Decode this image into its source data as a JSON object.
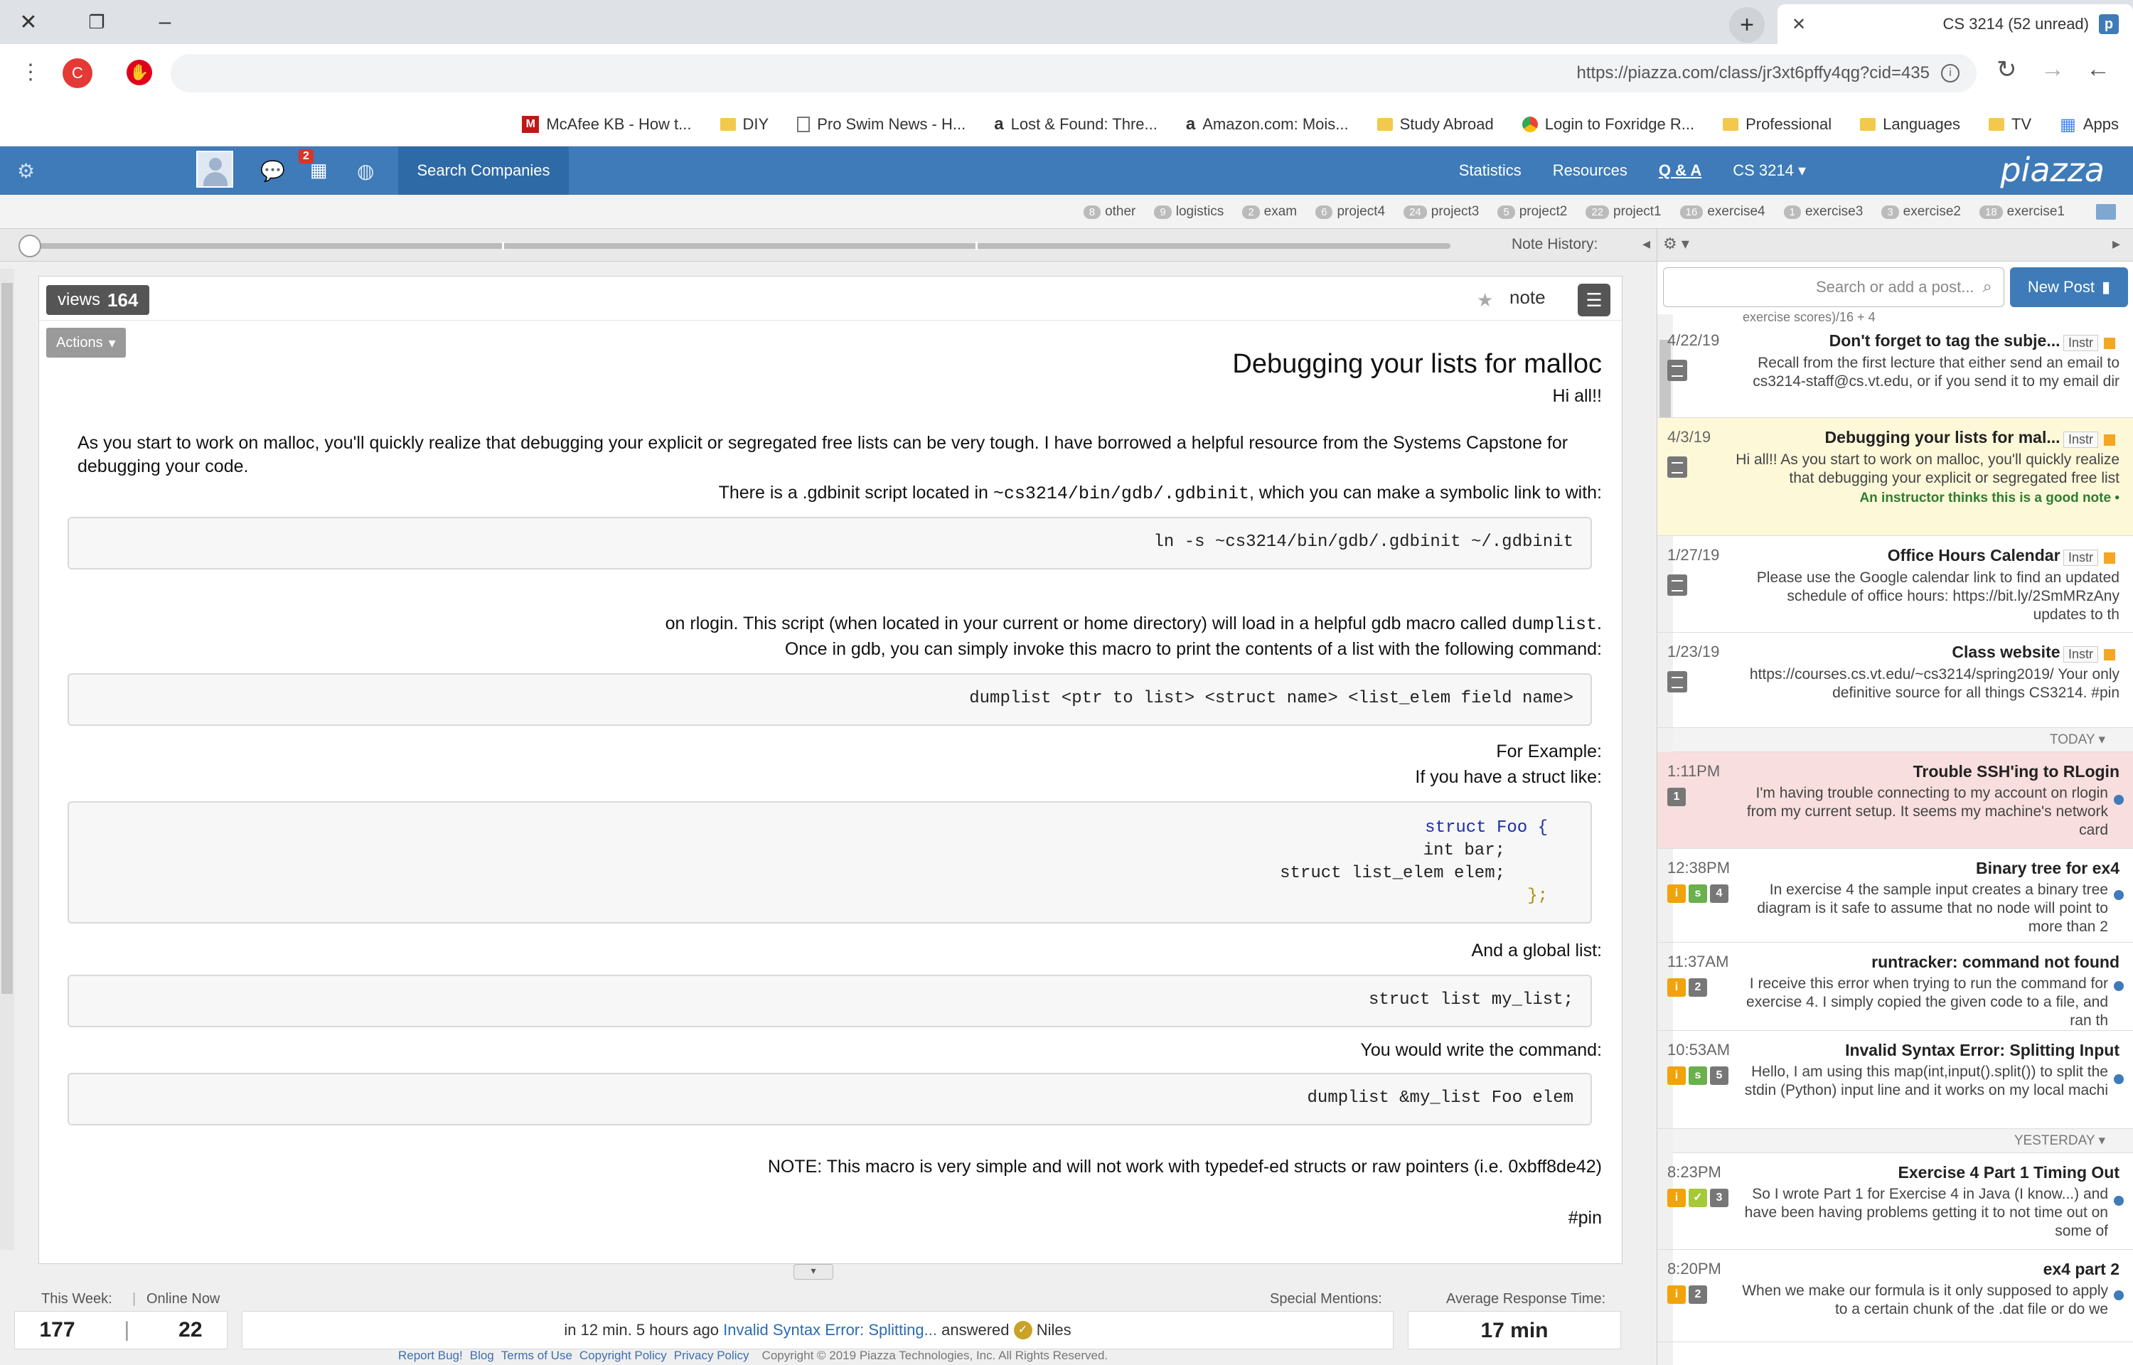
{
  "browser": {
    "tab_title": "CS 3214 (52 unread)",
    "url": "https://piazza.com/class/jr3xt6pffy4qg?cid=435",
    "bookmarks": [
      "Apps",
      "TV",
      "Languages",
      "Professional",
      "Login to Foxridge R...",
      "Study Abroad",
      "Amazon.com: Mois...",
      "Lost & Found: Thre...",
      "Pro Swim News - H...",
      "DIY",
      "McAfee KB - How t..."
    ],
    "profile_initial": "C"
  },
  "nav": {
    "logo": "piazza",
    "class_selector": "CS 3214",
    "tabs": [
      "Q & A",
      "Resources",
      "Statistics"
    ],
    "search_companies": "Search Companies",
    "notif_count": "2"
  },
  "folders": [
    {
      "name": "exercise1",
      "count": "18"
    },
    {
      "name": "exercise2",
      "count": "3"
    },
    {
      "name": "exercise3",
      "count": "1"
    },
    {
      "name": "exercise4",
      "count": "16"
    },
    {
      "name": "project1",
      "count": "22"
    },
    {
      "name": "project2",
      "count": "5"
    },
    {
      "name": "project3",
      "count": "24"
    },
    {
      "name": "project4",
      "count": "6"
    },
    {
      "name": "exam",
      "count": "2"
    },
    {
      "name": "logistics",
      "count": "9"
    },
    {
      "name": "other",
      "count": "8"
    }
  ],
  "sidebar": {
    "new_post": "New Post",
    "search_placeholder": "Search or add a post...",
    "top_snip": "exercise scores)/16 + 4",
    "pinned": [
      {
        "label": "Instr",
        "title": "Don't forget to tag the subje...",
        "snippet": "Recall from the first lecture that either send an email to cs3214-staff@cs.vt.edu, or if you send it to my email dir",
        "time": "4/22/19"
      },
      {
        "label": "Instr",
        "title": "Debugging your lists for mal...",
        "snippet": "Hi all!! As you start to work on malloc, you'll quickly realize that debugging your explicit or segregated free list",
        "time": "4/3/19",
        "good_note": "An instructor thinks this is a good note"
      },
      {
        "label": "Instr",
        "title": "Office Hours Calendar",
        "snippet": "Please use the Google calendar link to find an updated schedule of office hours: https://bit.ly/2SmMRzAny updates to th",
        "time": "1/27/19"
      },
      {
        "label": "Instr",
        "title": "Class website",
        "snippet": "https://courses.cs.vt.edu/~cs3214/spring2019/ Your only definitive source for all things CS3214. #pin",
        "time": "1/23/19"
      }
    ],
    "today_label": "TODAY",
    "today": [
      {
        "title": "Trouble SSH'ing to RLogin",
        "snippet": "I'm having trouble connecting to my account on rlogin from my current setup. It seems my machine's network card",
        "time": "1:11PM",
        "count": "1"
      },
      {
        "title": "Binary tree for ex4",
        "snippet": "In exercise 4 the sample input creates a binary tree diagram is it safe to assume that no node will point to more than 2",
        "time": "12:38PM",
        "count": "4"
      },
      {
        "title": "runtracker: command not found",
        "snippet": "I receive this error when trying to run the command for exercise 4. I simply copied the given code to a file, and ran th",
        "time": "11:37AM",
        "count": "2"
      },
      {
        "title": "Invalid Syntax Error: Splitting Input",
        "snippet": "Hello, I am using this map(int,input().split()) to split the stdin (Python) input line and it works on my local machi",
        "time": "10:53AM",
        "count": "5"
      }
    ],
    "yesterday_label": "YESTERDAY",
    "yesterday": [
      {
        "title": "Exercise 4 Part 1 Timing Out",
        "snippet": "So I wrote Part 1 for Exercise 4 in Java (I know...) and have been having problems getting it to not time out on some of",
        "time": "8:23PM",
        "count": "3"
      },
      {
        "title": "ex4 part 2",
        "snippet": "When we make our formula is it only supposed to apply to a certain chunk of the .dat file or do we",
        "time": "8:20PM",
        "count": "2"
      }
    ]
  },
  "note_history": "Note History:",
  "post": {
    "type_label": "note",
    "views": "164",
    "views_label": "views",
    "actions": "Actions",
    "title": "Debugging your lists for malloc",
    "greeting": "Hi all!!",
    "p1": "As you start to work on malloc, you'll quickly realize that debugging your explicit or segregated free lists can be very tough. I have borrowed a helpful resource from the Systems Capstone for debugging your code.",
    "p2_pre": "There is a .gdbinit script located in",
    "p2_path": "~cs3214/bin/gdb/.gdbinit",
    "p2_post": ", which you can make a symbolic link to with:",
    "code1": "ln -s ~cs3214/bin/gdb/.gdbinit ~/.gdbinit",
    "p3_pre": "on rlogin. This script (when located in your current or home directory) will load in a helpful gdb macro called",
    "p3_macro": "dumplist",
    "p3_line2": "Once in gdb, you can simply invoke this macro to print the contents of a list with the following command:",
    "code2": "dumplist <ptr to list> <struct name> <list_elem field name>",
    "for_example": "For Example:",
    "if_struct": "If you have a struct like:",
    "code3": [
      "struct Foo {",
      "    int bar;",
      "    struct list_elem elem;",
      "};"
    ],
    "and_global": "And a global list:",
    "code4": "struct list my_list;",
    "would_write": "You would write the command:",
    "code5": "dumplist &my_list Foo elem",
    "note": "NOTE: This macro is very simple and will not work with typedef-ed structs or raw pointers (i.e. 0xbff8de42)",
    "tag": "#pin"
  },
  "footer": {
    "avg_label": "Average Response Time:",
    "avg_value": "17 min",
    "special_label": "Special Mentions:",
    "mention_user": "Niles",
    "mention_answered": "answered",
    "mention_link": "Invalid Syntax Error: Splitting...",
    "mention_time": "in 12 min. 5 hours ago",
    "online_label": "Online Now",
    "week_label": "This Week:",
    "online_value": "22",
    "week_value": "177",
    "copyright": "Copyright © 2019 Piazza Technologies, Inc. All Rights Reserved.",
    "links": [
      "Privacy Policy",
      "Copyright Policy",
      "Terms of Use",
      "Blog",
      "Report Bug!"
    ]
  }
}
